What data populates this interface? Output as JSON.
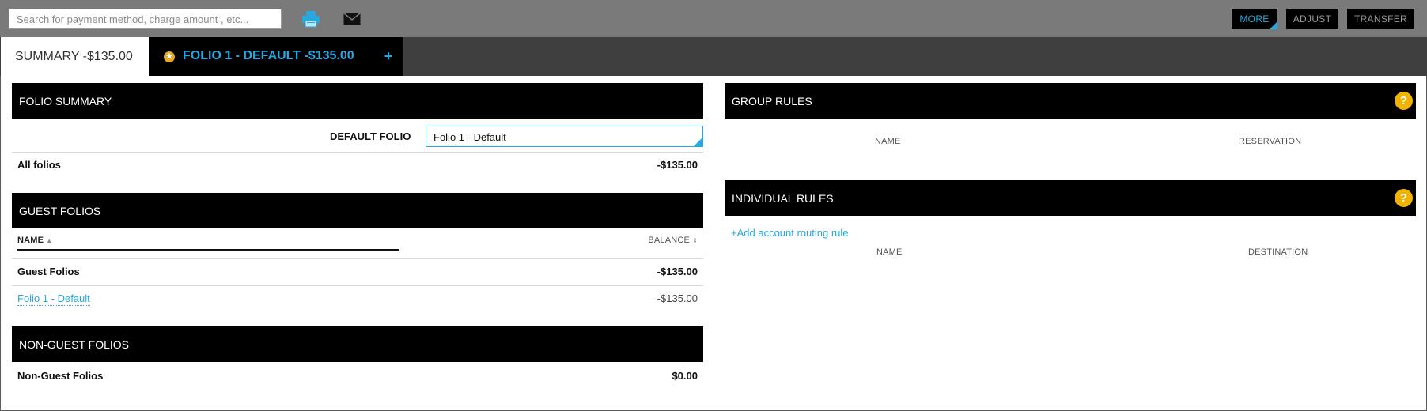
{
  "toolbar": {
    "search_placeholder": "Search for payment method, charge amount , etc...",
    "printer_icon": "printer-icon",
    "mail_icon": "mail-icon",
    "more_label": "MORE",
    "adjust_label": "ADJUST",
    "transfer_label": "TRANSFER"
  },
  "tabs": {
    "summary_label": "SUMMARY -$135.00",
    "folio_label": "FOLIO 1 - DEFAULT -$135.00",
    "folio_badge_icon": "star-badge-icon",
    "add_label": "+"
  },
  "folio_summary": {
    "title": "FOLIO SUMMARY",
    "default_folio_label": "DEFAULT FOLIO",
    "default_folio_value": "Folio 1 - Default",
    "all_folios_label": "All folios",
    "all_folios_amount": "-$135.00"
  },
  "guest_folios": {
    "title": "GUEST FOLIOS",
    "col_name": "NAME",
    "col_balance": "BALANCE",
    "group_label": "Guest Folios",
    "group_amount": "-$135.00",
    "rows": [
      {
        "name": "Folio 1 - Default",
        "balance": "-$135.00"
      }
    ]
  },
  "non_guest_folios": {
    "title": "NON-GUEST FOLIOS",
    "label": "Non-Guest Folios",
    "amount": "$0.00"
  },
  "group_rules": {
    "title": "GROUP RULES",
    "help": "?",
    "col_name": "NAME",
    "col_reservation": "RESERVATION"
  },
  "individual_rules": {
    "title": "INDIVIDUAL RULES",
    "help": "?",
    "add_link": "+Add account routing rule",
    "col_name": "NAME",
    "col_destination": "DESTINATION"
  },
  "colors": {
    "accent": "#29a8e0",
    "help_badge": "#f0b400",
    "toolbar_bg": "#7a7a7a",
    "tabbar_bg": "#3f3f3f",
    "panel_header": "#000000"
  }
}
